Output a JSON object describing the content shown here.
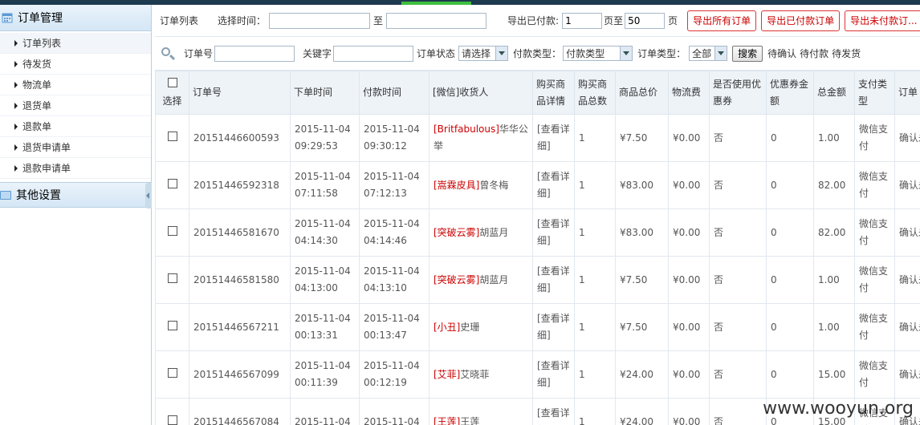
{
  "sidebar": {
    "group1_title": "订单管理",
    "items": [
      {
        "label": "订单列表"
      },
      {
        "label": "待发货"
      },
      {
        "label": "物流单"
      },
      {
        "label": "退货单"
      },
      {
        "label": "退款单"
      },
      {
        "label": "退货申请单"
      },
      {
        "label": "退款申请单"
      }
    ],
    "group2_title": "其他设置"
  },
  "filters": {
    "list_title": "订单列表",
    "select_time_label": "选择时间：",
    "to_label": "至",
    "export_paid_label": "导出已付款:",
    "page_from_value": "1",
    "page_to_label": "页至",
    "page_to_value": "50",
    "page_suffix": "页",
    "export_all_button": "导出所有订单",
    "export_paid_button": "导出已付款订单",
    "export_unpaid_button": "导出未付款订..."
  },
  "search": {
    "order_no_label": "订单号",
    "keyword_label": "关键字",
    "status_label": "订单状态",
    "status_value": "请选择",
    "pay_type_label": "付款类型：",
    "pay_type_value": "付款类型",
    "order_type_label": "订单类型：",
    "order_type_value": "全部",
    "search_button": "搜索",
    "quick_links": [
      "待确认",
      "待付款",
      "待发货"
    ]
  },
  "table": {
    "headers": [
      "选择",
      "订单号",
      "下单时间",
      "付款时间",
      "[微信]收货人",
      "购买商品详情",
      "购买商品总数",
      "商品总价",
      "物流费",
      "是否使用优惠券",
      "优惠券金额",
      "总金额",
      "支付类型",
      "订单"
    ],
    "rows": [
      {
        "order_no": "20151446600593",
        "order_date": "2015-11-04",
        "order_time": "09:29:53",
        "pay_date": "2015-11-04",
        "pay_time": "09:30:12",
        "nick": "[Britfabulous]",
        "name": "华华公举",
        "detail": "[查看详细]",
        "qty": "1",
        "price": "¥7.50",
        "shipping": "¥0.00",
        "coupon": "否",
        "coupon_amt": "0",
        "total": "1.00",
        "pay_type": "微信支付",
        "status": "确认未发"
      },
      {
        "order_no": "20151446592318",
        "order_date": "2015-11-04",
        "order_time": "07:11:58",
        "pay_date": "2015-11-04",
        "pay_time": "07:12:13",
        "nick": "[嵩霖皮具]",
        "name": "曾冬梅",
        "detail": "[查看详细]",
        "qty": "1",
        "price": "¥83.00",
        "shipping": "¥0.00",
        "coupon": "否",
        "coupon_amt": "0",
        "total": "82.00",
        "pay_type": "微信支付",
        "status": "确认未发"
      },
      {
        "order_no": "20151446581670",
        "order_date": "2015-11-04",
        "order_time": "04:14:30",
        "pay_date": "2015-11-04",
        "pay_time": "04:14:46",
        "nick": "[突破云雾]",
        "name": "胡蓝月",
        "detail": "[查看详细]",
        "qty": "1",
        "price": "¥83.00",
        "shipping": "¥0.00",
        "coupon": "否",
        "coupon_amt": "0",
        "total": "82.00",
        "pay_type": "微信支付",
        "status": "确认未发"
      },
      {
        "order_no": "20151446581580",
        "order_date": "2015-11-04",
        "order_time": "04:13:00",
        "pay_date": "2015-11-04",
        "pay_time": "04:13:10",
        "nick": "[突破云雾]",
        "name": "胡蓝月",
        "detail": "[查看详细]",
        "qty": "1",
        "price": "¥7.50",
        "shipping": "¥0.00",
        "coupon": "否",
        "coupon_amt": "0",
        "total": "1.00",
        "pay_type": "微信支付",
        "status": "确认未发"
      },
      {
        "order_no": "20151446567211",
        "order_date": "2015-11-04",
        "order_time": "00:13:31",
        "pay_date": "2015-11-04",
        "pay_time": "00:13:47",
        "nick": "[小丑]",
        "name": "史珊",
        "detail": "[查看详细]",
        "qty": "1",
        "price": "¥7.50",
        "shipping": "¥0.00",
        "coupon": "否",
        "coupon_amt": "0",
        "total": "1.00",
        "pay_type": "微信支付",
        "status": "确认未发"
      },
      {
        "order_no": "20151446567099",
        "order_date": "2015-11-04",
        "order_time": "00:11:39",
        "pay_date": "2015-11-04",
        "pay_time": "00:12:19",
        "nick": "[艾菲]",
        "name": "艾晓菲",
        "detail": "[查看详细]",
        "qty": "1",
        "price": "¥24.00",
        "shipping": "¥0.00",
        "coupon": "否",
        "coupon_amt": "0",
        "total": "15.00",
        "pay_type": "微信支付",
        "status": "确认未发"
      },
      {
        "order_no": "20151446567084",
        "order_date": "2015-11-04",
        "order_time": "",
        "pay_date": "2015-11-04",
        "pay_time": "",
        "nick": "[王莲]",
        "name": "王莲",
        "detail": "[查看详细]",
        "qty": "1",
        "price": "¥24.00",
        "shipping": "¥0.00",
        "coupon": "否",
        "coupon_amt": "0",
        "total": "15.00",
        "pay_type": "微信支付",
        "status": "确认未发"
      }
    ]
  },
  "watermark": "www.wooyun.org"
}
